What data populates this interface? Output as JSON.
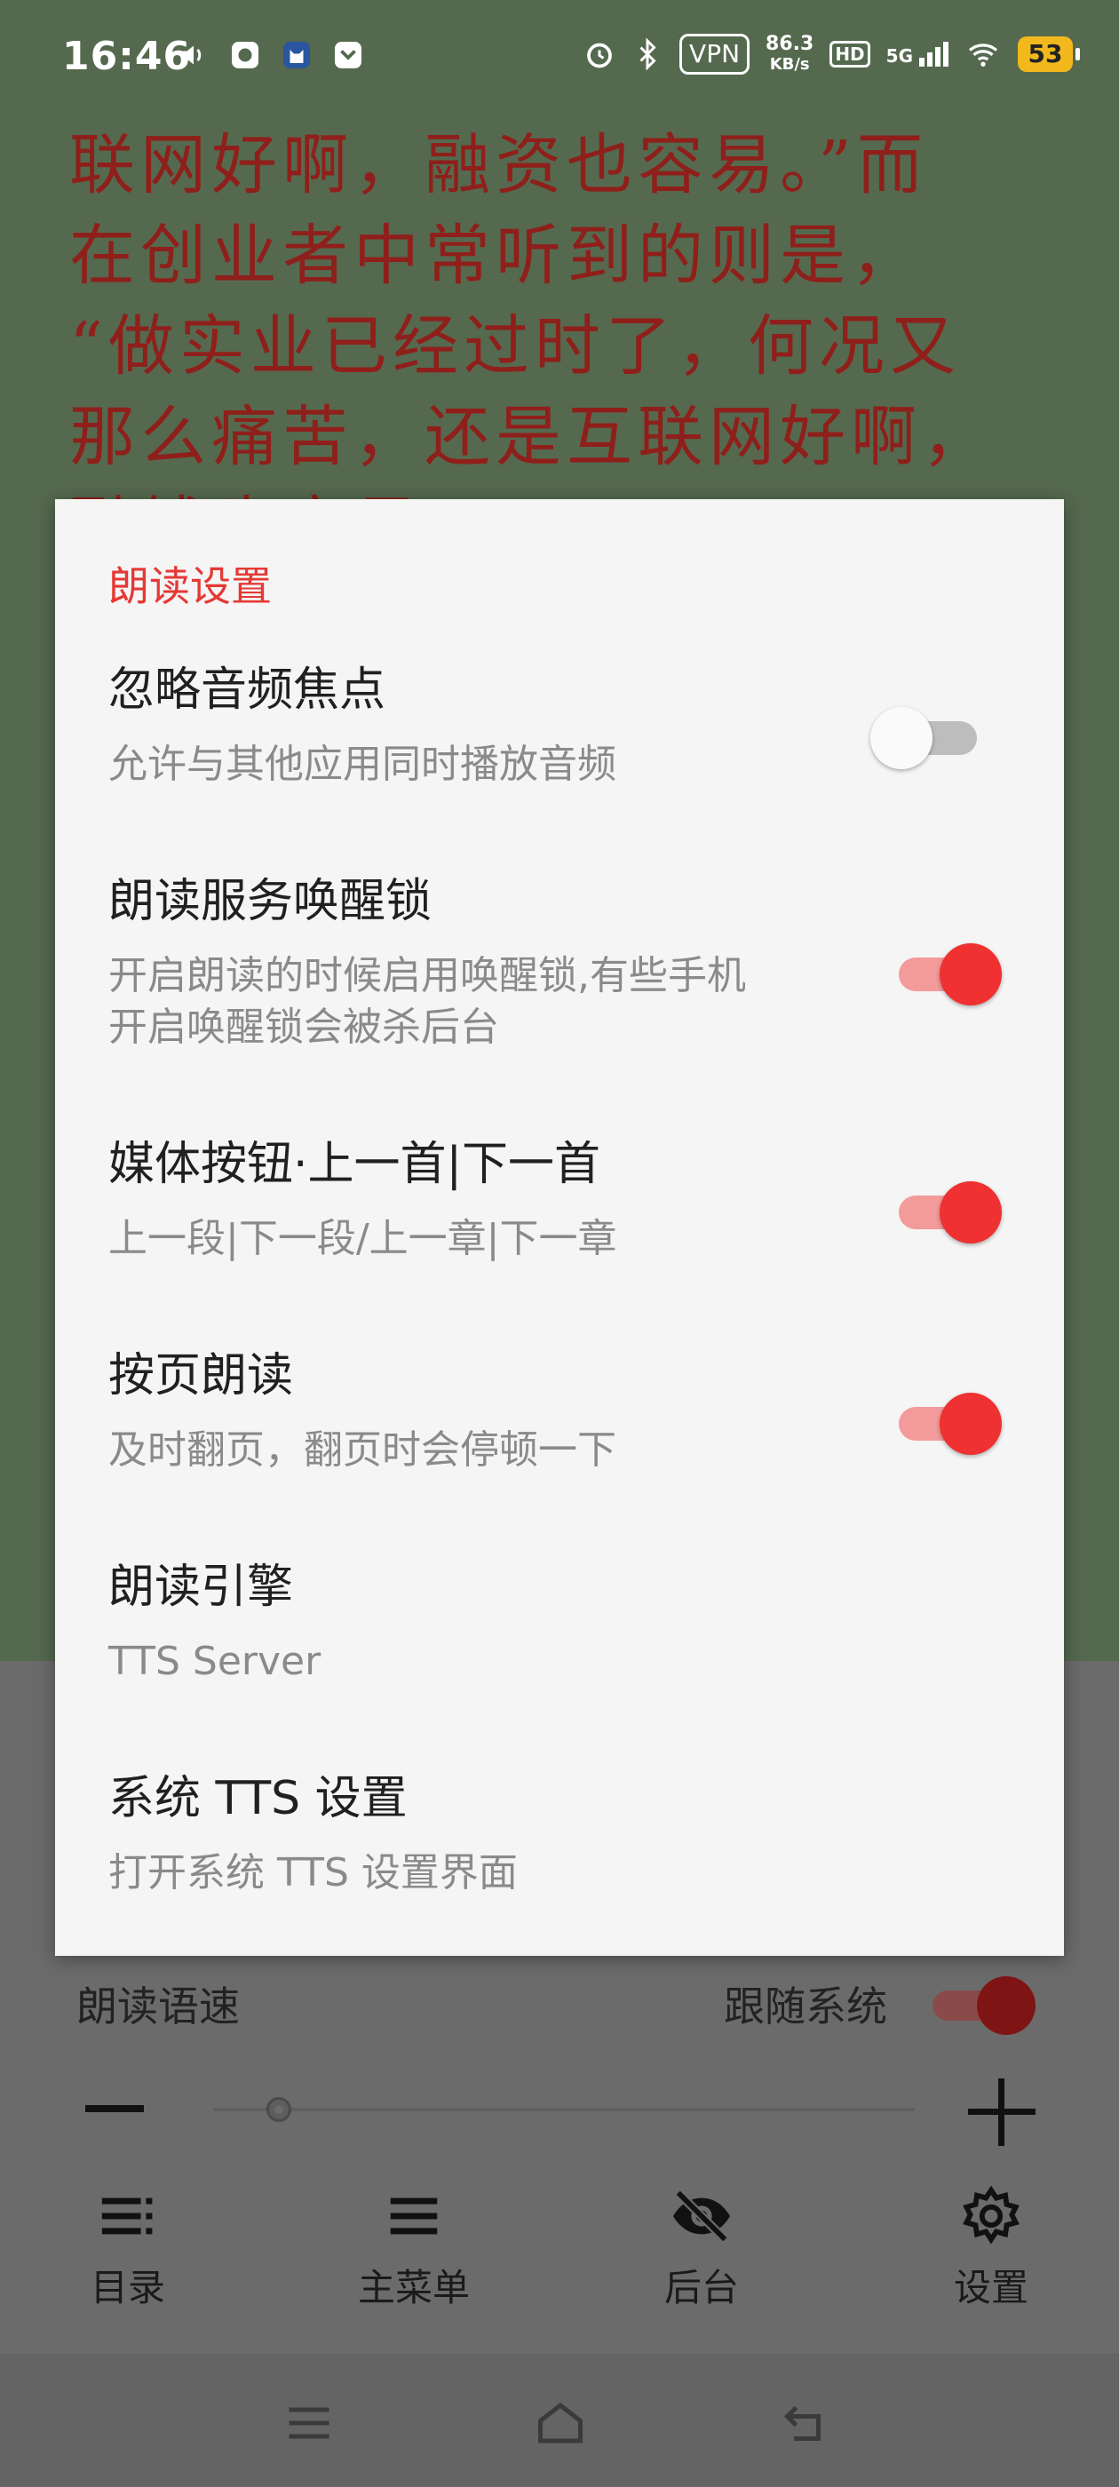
{
  "status_bar": {
    "time": "16:46",
    "network_speed_value": "86.3",
    "network_speed_unit": "KB/s",
    "vpn": "VPN",
    "hd": "HD",
    "signal": "5G",
    "battery": "53"
  },
  "reader": {
    "lines": [
      "联网好啊，融资也容易。”而",
      "在创业者中常听到的则是，",
      "“做实业已经过时了，何况又",
      "那么痛苦，还是互联网好啊，",
      "融钱也容易。”"
    ]
  },
  "dialog": {
    "title": "朗读设置",
    "items": [
      {
        "title": "忽略音频焦点",
        "summary": "允许与其他应用同时播放音频",
        "switch": false
      },
      {
        "title": "朗读服务唤醒锁",
        "summary_lines": [
          "开启朗读的时候启用唤醒锁,有些手机",
          "开启唤醒锁会被杀后台"
        ],
        "switch": true
      },
      {
        "title": "媒体按钮·上一首|下一首",
        "summary": "上一段|下一段/上一章|下一章",
        "switch": true
      },
      {
        "title": "按页朗读",
        "summary": "及时翻页，翻页时会停顿一下",
        "switch": true
      },
      {
        "title": "朗读引擎",
        "summary": "TTS Server"
      },
      {
        "title": "系统 TTS 设置",
        "summary": "打开系统 TTS 设置界面"
      }
    ]
  },
  "read_aloud_panel": {
    "speed_label": "朗读语速",
    "follow_system_label": "跟随系统",
    "follow_system": true,
    "speed_slider_fraction": 0.1,
    "nav": [
      {
        "label": "目录",
        "icon": "list-icon"
      },
      {
        "label": "主菜单",
        "icon": "menu-icon"
      },
      {
        "label": "后台",
        "icon": "eye-off-icon"
      },
      {
        "label": "设置",
        "icon": "gear-icon"
      }
    ]
  },
  "colors": {
    "accent": "#ef3131",
    "reader_bg": "#55694f",
    "reader_text": "#8f1f1a"
  }
}
